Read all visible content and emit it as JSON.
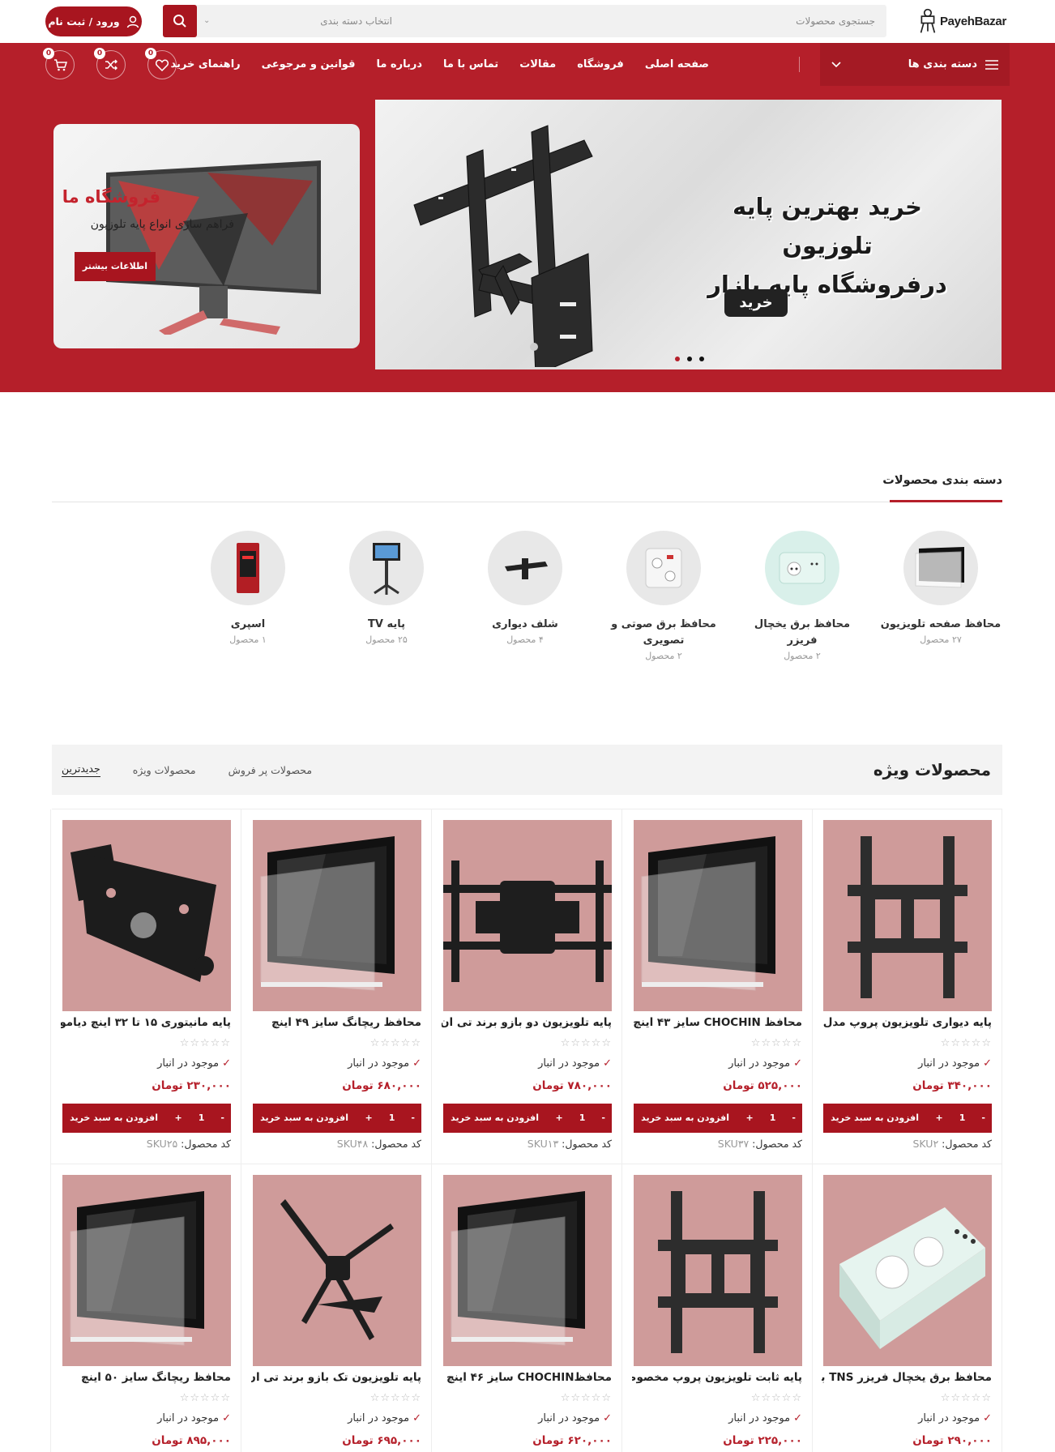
{
  "header": {
    "logo_text": "PayehBazar",
    "search_placeholder": "جستجوی محصولات",
    "category_select": "انتخاب دسته بندی",
    "login_label": "ورود / ثبت نام"
  },
  "nav": {
    "categories_label": "دسته بندی ها",
    "links": [
      "صفحه اصلی",
      "فروشگاه",
      "مقالات",
      "تماس با ما",
      "درباره ما",
      "قوانین و مرجوعی",
      "راهنمای خرید"
    ],
    "badges": {
      "wishlist": "0",
      "compare": "0",
      "cart": "0"
    }
  },
  "hero": {
    "slide_title_line1": "خرید بهترین پایه تلوزیون",
    "slide_title_line2": "درفروشگاه پایه بازار",
    "slide_button": "خرید",
    "promo_title": "فروشگاه ما",
    "promo_subtitle": "فراهم سازی انواع پایه تلوزیون",
    "promo_button": "اطلاعات بیشتر"
  },
  "categories": {
    "title": "دسته بندی محصولات",
    "items": [
      {
        "name": "محافظ صفحه تلویزیون",
        "count": "۲۷ محصول"
      },
      {
        "name": "محافظ برق یخچال فریزر",
        "count": "۲ محصول"
      },
      {
        "name": "محافظ برق صوتی و تصویری",
        "count": "۲ محصول"
      },
      {
        "name": "شلف دیواری",
        "count": "۴ محصول"
      },
      {
        "name": "پایه TV",
        "count": "۲۵ محصول"
      },
      {
        "name": "اسپری",
        "count": "۱ محصول"
      }
    ]
  },
  "featured": {
    "title": "محصولات ویژه",
    "tabs": [
      "جدیدترین",
      "محصولات ویژه",
      "محصولات پر فروش"
    ],
    "stock_label": "موجود در انبار",
    "add_to_cart": "افزودن به سبد خرید",
    "sku_label": "کد محصول:",
    "qty": "1",
    "products": [
      {
        "name": "پایه دیواری تلویزیون پروپ مدل",
        "price": "۳۴۰,۰۰۰ تومان",
        "sku": "SKU۲",
        "image": "mount-icon"
      },
      {
        "name": "محافظ CHOCHIN سایز ۴۳ اینچ",
        "price": "۵۲۵,۰۰۰ تومان",
        "sku": "SKU۳۷",
        "image": "screen-icon"
      },
      {
        "name": "پایه تلویزیون دو بازو برند تی ان اس",
        "price": "۷۸۰,۰۰۰ تومان",
        "sku": "SKU۱۳",
        "image": "double-arm-icon"
      },
      {
        "name": "محافظ ریچانگ سایز ۴۹ اینچ",
        "price": "۶۸۰,۰۰۰ تومان",
        "sku": "SKU۴۸",
        "image": "screen-icon"
      },
      {
        "name": "پایه مانیتوری ۱۵ تا ۳۲ اینچ دیاموند",
        "price": "۲۳۰,۰۰۰ تومان",
        "sku": "SKU۲۵",
        "image": "vesa-icon"
      },
      {
        "name": "محافظ برق یخچال فریزر TNS با",
        "price": "۲۹۰,۰۰۰ تومان",
        "sku": "",
        "image": "socket-icon"
      },
      {
        "name": "پایه ثابت تلویزیون پروپ مخصوص",
        "price": "۲۲۵,۰۰۰ تومان",
        "sku": "",
        "image": "mount-icon"
      },
      {
        "name": "محافظCHOCHIN سایز ۴۶ اینچ",
        "price": "۶۲۰,۰۰۰ تومان",
        "sku": "",
        "image": "screen-icon"
      },
      {
        "name": "پایه تلویزیون تک بازو برند تی ان اس",
        "price": "۶۹۵,۰۰۰ تومان",
        "sku": "",
        "image": "single-arm-icon"
      },
      {
        "name": "محافظ ریچانگ سایز ۵۰ اینچ",
        "price": "۸۹۵,۰۰۰ تومان",
        "sku": "",
        "image": "screen-icon"
      }
    ]
  },
  "colors": {
    "brand": "#b51f2a",
    "brand_dark": "#a8151f",
    "card_image_bg": "#cf9b9a"
  }
}
